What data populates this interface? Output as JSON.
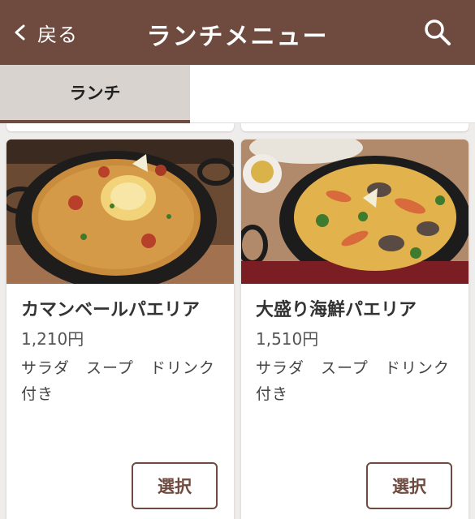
{
  "header": {
    "back_label": "戻る",
    "title": "ランチメニュー",
    "search_icon": "search-icon",
    "back_icon": "chevron-left-icon"
  },
  "tabs": [
    {
      "label": "ランチ",
      "active": true
    }
  ],
  "menu": {
    "items": [
      {
        "name": "カマンベールパエリア",
        "price": "1,210円",
        "description": "サラダ　スープ　ドリンク付き",
        "select_label": "選択"
      },
      {
        "name": "大盛り海鮮パエリア",
        "price": "1,510円",
        "description": "サラダ　スープ　ドリンク付き",
        "select_label": "選択"
      }
    ]
  },
  "colors": {
    "brand": "#6e4a3f",
    "active_tab_bg": "#d9d3cf",
    "page_bg": "#efedec"
  }
}
